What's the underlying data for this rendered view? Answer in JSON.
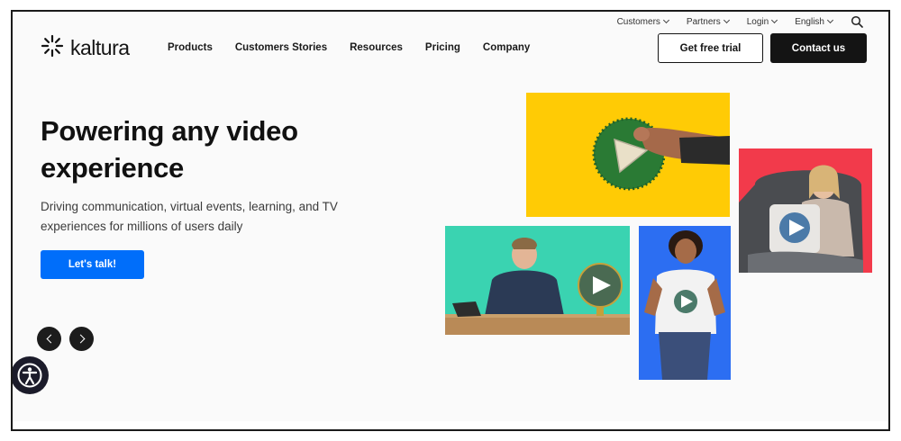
{
  "utility": {
    "items": [
      {
        "label": "Customers"
      },
      {
        "label": "Partners"
      },
      {
        "label": "Login"
      },
      {
        "label": "English"
      }
    ],
    "search_icon": "search-icon"
  },
  "header": {
    "logo_text": "kaltura",
    "logo_icon": "kaltura-burst-icon",
    "nav": [
      {
        "label": "Products"
      },
      {
        "label": "Customers Stories"
      },
      {
        "label": "Resources"
      },
      {
        "label": "Pricing"
      },
      {
        "label": "Company"
      }
    ],
    "trial_label": "Get free trial",
    "contact_label": "Contact us"
  },
  "hero": {
    "title": "Powering any video experience",
    "subtitle": "Driving communication, virtual events, learning, and TV experiences for millions of users daily",
    "cta_label": "Let's talk!",
    "prev_icon": "chevron-left-icon",
    "next_icon": "chevron-right-icon"
  },
  "colors": {
    "cta_blue": "#006efa",
    "dark": "#141414",
    "tile_yellow": "#ffcb05",
    "tile_red": "#f23a4b",
    "tile_green": "#3ad3b1",
    "tile_blue": "#2c6ef2"
  },
  "accessibility_icon": "accessibility-icon"
}
